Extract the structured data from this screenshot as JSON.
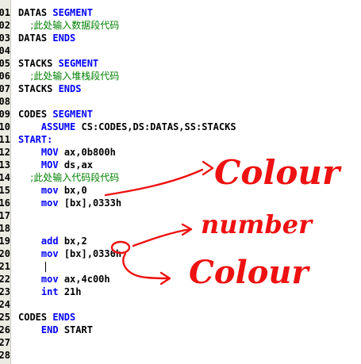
{
  "editor": {
    "lines": [
      {
        "num": "01",
        "segs": [
          {
            "t": "DATAS ",
            "c": "id"
          },
          {
            "t": "SEGMENT",
            "c": "kw"
          }
        ]
      },
      {
        "num": "02",
        "segs": [
          {
            "t": "    ;此处输入数据段代码",
            "c": "cm"
          }
        ]
      },
      {
        "num": "03",
        "segs": [
          {
            "t": "DATAS ",
            "c": "id"
          },
          {
            "t": "ENDS",
            "c": "kw"
          }
        ]
      },
      {
        "num": "04",
        "segs": []
      },
      {
        "num": "05",
        "segs": [
          {
            "t": "STACKS ",
            "c": "id"
          },
          {
            "t": "SEGMENT",
            "c": "kw"
          }
        ]
      },
      {
        "num": "06",
        "segs": [
          {
            "t": "    ;此处输入堆栈段代码",
            "c": "cm"
          }
        ]
      },
      {
        "num": "07",
        "segs": [
          {
            "t": "STACKS ",
            "c": "id"
          },
          {
            "t": "ENDS",
            "c": "kw"
          }
        ]
      },
      {
        "num": "08",
        "segs": []
      },
      {
        "num": "09",
        "segs": [
          {
            "t": "CODES ",
            "c": "id"
          },
          {
            "t": "SEGMENT",
            "c": "kw"
          }
        ]
      },
      {
        "num": "10",
        "segs": [
          {
            "t": "    ",
            "c": "id"
          },
          {
            "t": "ASSUME",
            "c": "kw"
          },
          {
            "t": " CS:CODES,DS:DATAS,SS:STACKS",
            "c": "id"
          }
        ]
      },
      {
        "num": "11",
        "segs": [
          {
            "t": "START:",
            "c": "kw"
          }
        ]
      },
      {
        "num": "12",
        "segs": [
          {
            "t": "    ",
            "c": "id"
          },
          {
            "t": "MOV",
            "c": "kw"
          },
          {
            "t": " ax,0b800h",
            "c": "id"
          }
        ]
      },
      {
        "num": "13",
        "segs": [
          {
            "t": "    ",
            "c": "id"
          },
          {
            "t": "MOV",
            "c": "kw"
          },
          {
            "t": " ds,ax",
            "c": "id"
          }
        ]
      },
      {
        "num": "14",
        "segs": [
          {
            "t": "    ;此处输入代码段代码",
            "c": "cm"
          }
        ]
      },
      {
        "num": "15",
        "segs": [
          {
            "t": "    ",
            "c": "id"
          },
          {
            "t": "mov",
            "c": "kw"
          },
          {
            "t": " bx,0",
            "c": "id"
          }
        ]
      },
      {
        "num": "16",
        "segs": [
          {
            "t": "    ",
            "c": "id"
          },
          {
            "t": "mov",
            "c": "kw"
          },
          {
            "t": " [bx],0333h",
            "c": "id"
          }
        ]
      },
      {
        "num": "17",
        "segs": []
      },
      {
        "num": "18",
        "segs": []
      },
      {
        "num": "19",
        "segs": [
          {
            "t": "    ",
            "c": "id"
          },
          {
            "t": "add",
            "c": "kw"
          },
          {
            "t": " bx,2",
            "c": "id"
          }
        ]
      },
      {
        "num": "20",
        "segs": [
          {
            "t": "    ",
            "c": "id"
          },
          {
            "t": "mov",
            "c": "kw"
          },
          {
            "t": " [bx],0336h",
            "c": "id"
          }
        ]
      },
      {
        "num": "21",
        "segs": []
      },
      {
        "num": "22",
        "segs": [
          {
            "t": "    ",
            "c": "id"
          },
          {
            "t": "mov",
            "c": "kw"
          },
          {
            "t": " ax,4c00h",
            "c": "id"
          }
        ]
      },
      {
        "num": "23",
        "segs": [
          {
            "t": "    ",
            "c": "id"
          },
          {
            "t": "int",
            "c": "kw"
          },
          {
            "t": " 21h",
            "c": "id"
          }
        ]
      },
      {
        "num": "24",
        "segs": []
      },
      {
        "num": "25",
        "segs": [
          {
            "t": "CODES ",
            "c": "id"
          },
          {
            "t": "ENDS",
            "c": "kw"
          }
        ]
      },
      {
        "num": "26",
        "segs": [
          {
            "t": "    ",
            "c": "id"
          },
          {
            "t": "END",
            "c": "kw"
          },
          {
            "t": " START",
            "c": "id"
          }
        ]
      },
      {
        "num": "27",
        "segs": []
      },
      {
        "num": "28",
        "segs": []
      }
    ]
  },
  "annotations": {
    "colour_top": "Colour",
    "number": "number",
    "colour_bottom": "Colour"
  },
  "colors": {
    "keyword": "#0000ff",
    "comment": "#008000",
    "ink": "#ee1111",
    "gutter": "#ecebe2"
  }
}
